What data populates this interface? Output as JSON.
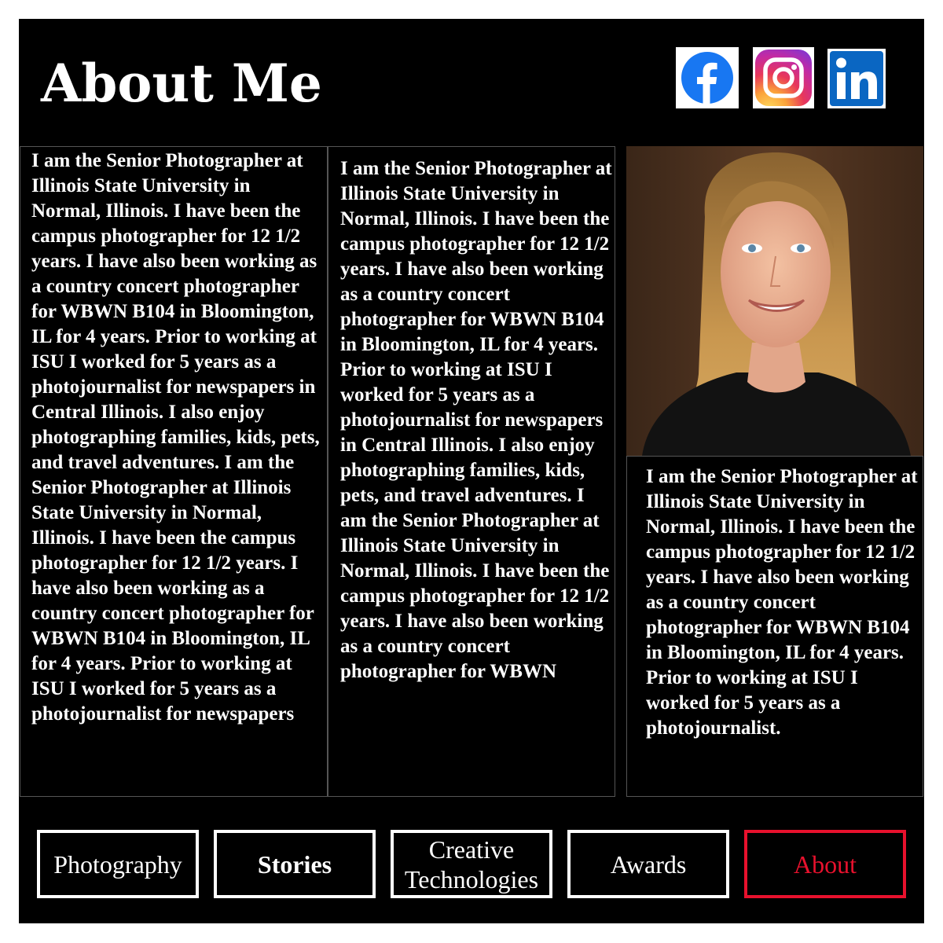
{
  "page": {
    "title": "About Me"
  },
  "social": [
    {
      "name": "facebook-icon",
      "color": "#1877f2"
    },
    {
      "name": "instagram-icon",
      "color": "#e1306c"
    },
    {
      "name": "linkedin-icon",
      "color": "#0a66c2"
    }
  ],
  "columns": {
    "col1": "I am the Senior Photographer at Illinois State University in Normal, Illinois. I have been the campus photographer for 12 1/2 years. I have also been working as a country concert photographer for WBWN B104 in Bloomington, IL for 4 years. Prior to working at ISU I worked for 5 years as a photojournalist for newspapers in Central Illinois. I also enjoy photographing families, kids, pets, and travel adventures. I am the Senior Photographer at Illinois State University in Normal, Illinois. I have been the campus photographer for 12 1/2 years. I have also been working as a country concert photographer for WBWN B104 in Bloomington, IL for 4 years. Prior to working at ISU I worked for 5 years as a photojournalist for newspapers",
    "col2": "I am the Senior Photographer at\nIllinois State University in Normal, Illinois. I have been the\ncampus photographer for 12 1/2 years. I have also been working as a country concert photographer for WBWN B104\nin Bloomington, IL for 4 years. Prior to working at ISU I worked for 5 years as a photojournalist for newspapers\nin Central Illinois. I also enjoy photographing families, kids, pets, and travel adventures. I am the Senior Photographer at Illinois State University in Normal, Illinois. I have been the campus photographer for 12 1/2 years. I have also been working as a country concert photographer for WBWN",
    "col3": "I am the Senior Photographer at\nIllinois State University in Normal, Illinois. I have been the\ncampus photographer for 12 1/2 years. I have also been working as a country concert photographer for WBWN B104\nin Bloomington, IL for 4 years. Prior to working at ISU I worked for 5 years as a photojournalist."
  },
  "nav": {
    "photography": "Photography",
    "stories": "Stories",
    "creative": "Creative\nTechnologies",
    "awards": "Awards",
    "about": "About"
  },
  "colors": {
    "accent": "#e8112d",
    "background": "#000000",
    "text": "#ffffff"
  }
}
